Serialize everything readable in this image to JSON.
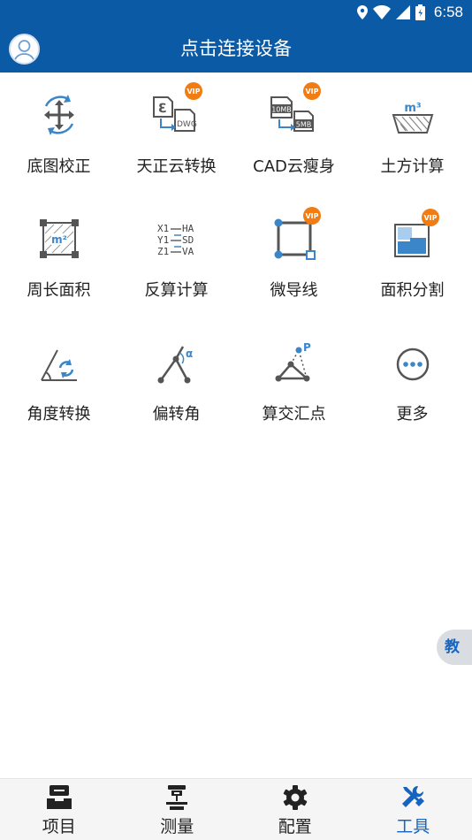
{
  "status_bar": {
    "time": "6:58"
  },
  "header": {
    "title": "点击连接设备"
  },
  "tools": [
    {
      "label": "底图校正",
      "icon": "move-rotate-icon",
      "vip": false
    },
    {
      "label": "天正云转换",
      "icon": "file-convert-dwg-icon",
      "vip": true
    },
    {
      "label": "CAD云瘦身",
      "icon": "file-compress-icon",
      "vip": true
    },
    {
      "label": "土方计算",
      "icon": "earthwork-icon",
      "vip": false
    },
    {
      "label": "周长面积",
      "icon": "area-icon",
      "vip": false
    },
    {
      "label": "反算计算",
      "icon": "inverse-calc-icon",
      "vip": false
    },
    {
      "label": "微导线",
      "icon": "traverse-icon",
      "vip": true
    },
    {
      "label": "面积分割",
      "icon": "area-split-icon",
      "vip": true
    },
    {
      "label": "角度转换",
      "icon": "angle-convert-icon",
      "vip": false
    },
    {
      "label": "偏转角",
      "icon": "deflection-angle-icon",
      "vip": false
    },
    {
      "label": "算交汇点",
      "icon": "intersection-icon",
      "vip": false
    },
    {
      "label": "更多",
      "icon": "more-icon",
      "vip": false
    }
  ],
  "icon_text": {
    "vip": "VIP",
    "dwg": "DWG",
    "size_before": "10MB",
    "size_after": "5MB",
    "m3": "m³",
    "m2": "m²",
    "x1": "X1",
    "y1": "Y1",
    "z1": "Z1",
    "ha": "HA",
    "sd": "SD",
    "va": "VA",
    "alpha": "α",
    "p": "P"
  },
  "side_tab": {
    "label": "教"
  },
  "bottom_nav": [
    {
      "label": "项目",
      "icon": "project-icon",
      "active": false
    },
    {
      "label": "测量",
      "icon": "survey-icon",
      "active": false
    },
    {
      "label": "配置",
      "icon": "settings-gear-icon",
      "active": false
    },
    {
      "label": "工具",
      "icon": "tools-icon",
      "active": true
    }
  ],
  "colors": {
    "brand": "#0b5aa6",
    "accent": "#1565c0",
    "vip": "#f07c13",
    "icon_gray": "#555555",
    "icon_blue": "#3b86c9"
  }
}
